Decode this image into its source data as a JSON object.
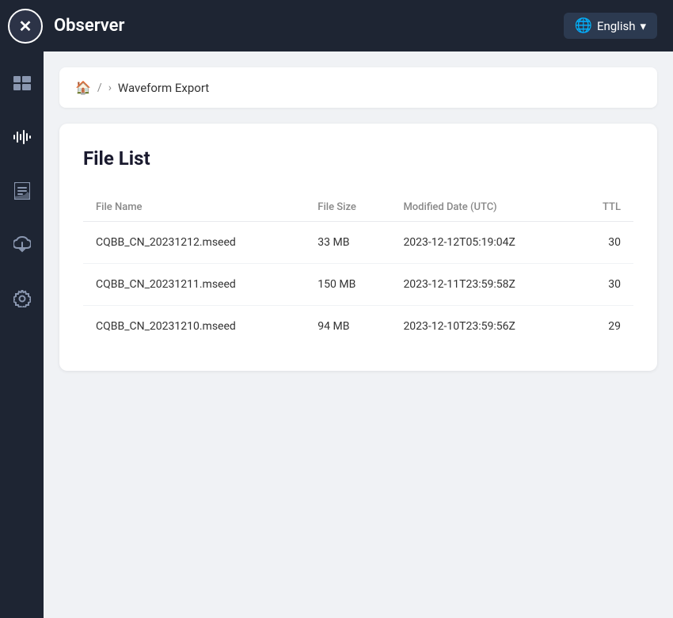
{
  "header": {
    "logo_icon": "✕",
    "app_title": "Observer",
    "lang_label": "English"
  },
  "sidebar": {
    "items": [
      {
        "id": "dashboard",
        "icon": "▦",
        "label": "Dashboard"
      },
      {
        "id": "waveform",
        "icon": "⏦",
        "label": "Waveform"
      },
      {
        "id": "report",
        "icon": "📋",
        "label": "Report"
      },
      {
        "id": "download",
        "icon": "☁",
        "label": "Download"
      },
      {
        "id": "settings",
        "icon": "⚙",
        "label": "Settings"
      }
    ]
  },
  "breadcrumb": {
    "home_icon": "🏠",
    "separator1": "/",
    "separator2": "›",
    "current": "Waveform Export"
  },
  "file_list": {
    "title": "File List",
    "columns": {
      "file_name": "File Name",
      "file_size": "File Size",
      "modified_date": "Modified Date (UTC)",
      "ttl": "TTL"
    },
    "rows": [
      {
        "file_name": "CQBB_CN_20231212.mseed",
        "file_size": "33 MB",
        "modified_date": "2023-12-12T05:19:04Z",
        "ttl": "30"
      },
      {
        "file_name": "CQBB_CN_20231211.mseed",
        "file_size": "150 MB",
        "modified_date": "2023-12-11T23:59:58Z",
        "ttl": "30"
      },
      {
        "file_name": "CQBB_CN_20231210.mseed",
        "file_size": "94 MB",
        "modified_date": "2023-12-10T23:59:56Z",
        "ttl": "29"
      }
    ]
  }
}
